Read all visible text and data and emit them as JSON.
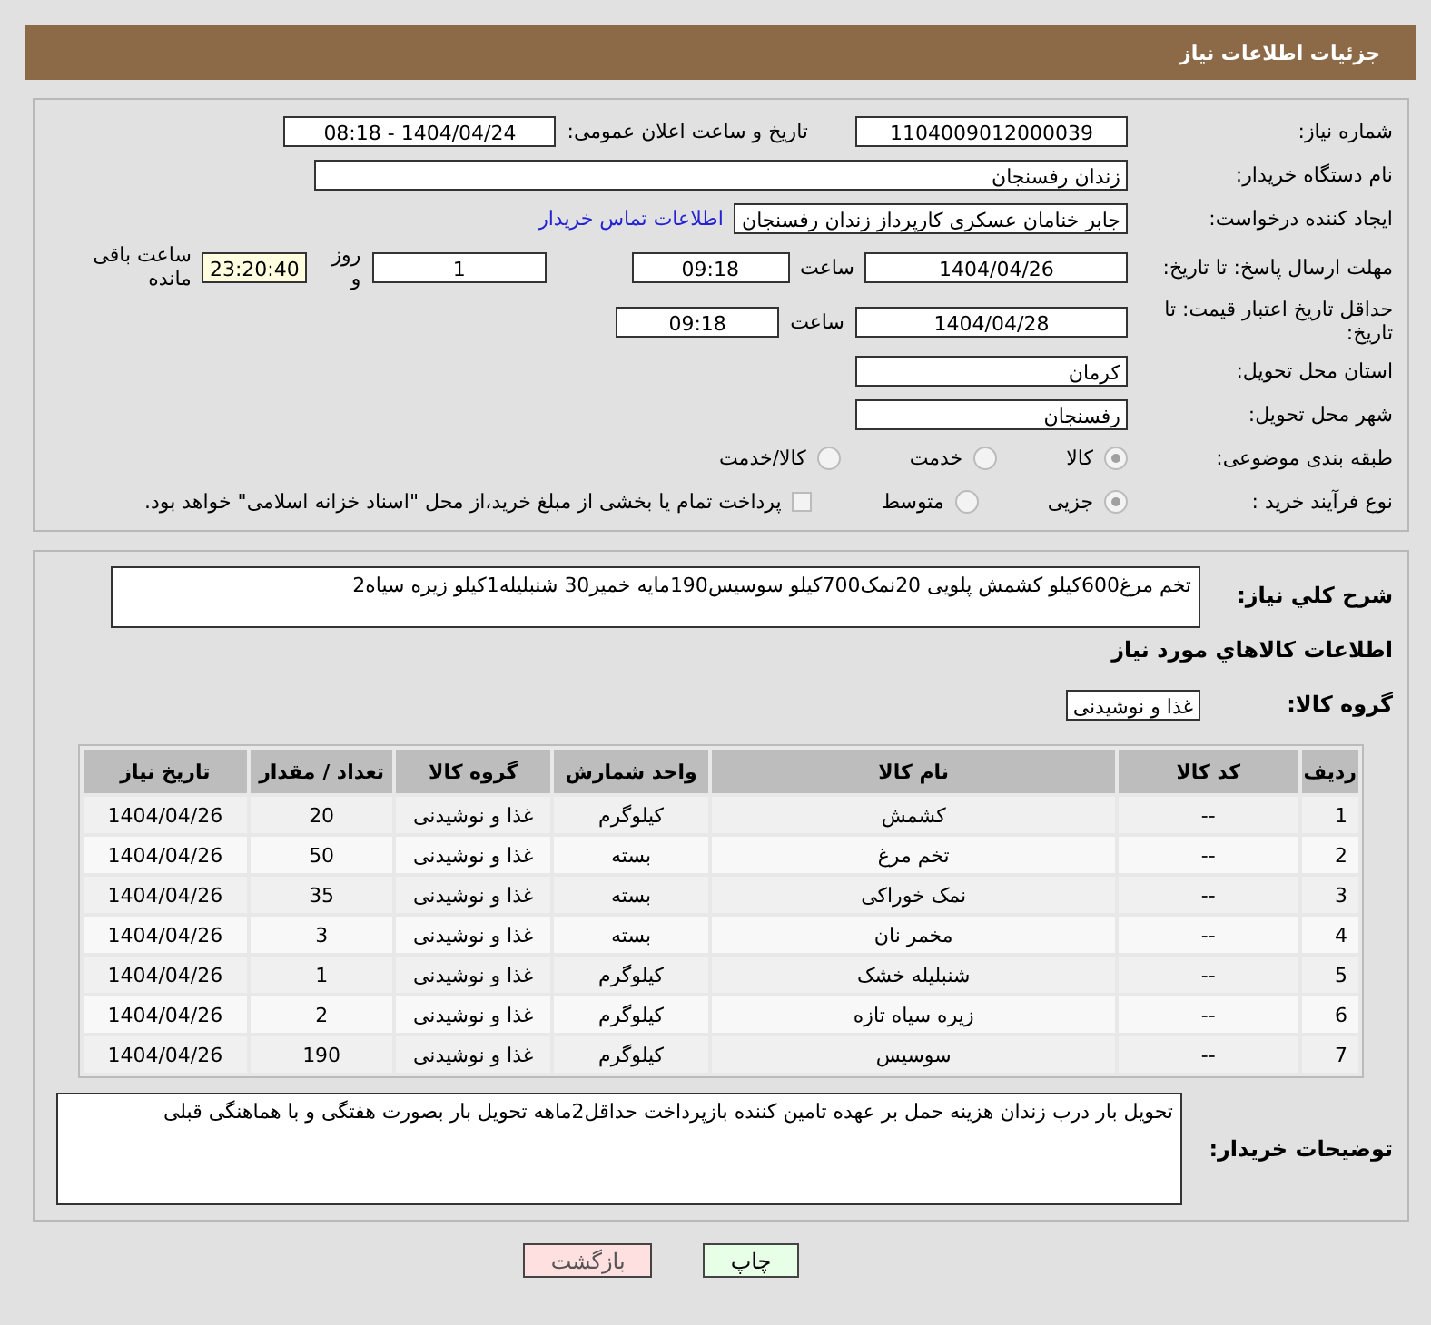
{
  "header": {
    "title": "جزئیات اطلاعات نیاز"
  },
  "form": {
    "need_number": {
      "label": "شماره نیاز:",
      "value": "1104009012000039"
    },
    "announce": {
      "label": "تاریخ و ساعت اعلان عمومی:",
      "value": "1404/04/24 - 08:18"
    },
    "buyer": {
      "label": "نام دستگاه خریدار:",
      "value": "زندان رفسنجان"
    },
    "creator": {
      "label": "ایجاد کننده درخواست:",
      "value": "جابر خنامان عسکری کارپرداز زندان رفسنجان",
      "link": "اطلاعات تماس خریدار"
    },
    "deadline": {
      "label": "مهلت ارسال پاسخ: تا تاریخ:",
      "date": "1404/04/26",
      "time_label": "ساعت",
      "time": "09:18",
      "days": "1",
      "days_label": "روز و",
      "remaining": "23:20:40",
      "remaining_label": "ساعت باقی مانده"
    },
    "validity": {
      "label": "حداقل تاریخ اعتبار قیمت: تا تاریخ:",
      "date": "1404/04/28",
      "time_label": "ساعت",
      "time": "09:18"
    },
    "province": {
      "label": "استان محل تحویل:",
      "value": "کرمان"
    },
    "city": {
      "label": "شهر محل تحویل:",
      "value": "رفسنجان"
    },
    "category": {
      "label": "طبقه بندی موضوعی:",
      "options": [
        {
          "label": "کالا",
          "selected": true
        },
        {
          "label": "خدمت",
          "selected": false
        },
        {
          "label": "کالا/خدمت",
          "selected": false
        }
      ]
    },
    "process": {
      "label": "نوع فرآیند خرید :",
      "options": [
        {
          "label": "جزیی",
          "selected": true
        },
        {
          "label": "متوسط",
          "selected": false
        }
      ],
      "treasury": {
        "label": "پرداخت تمام یا بخشی از مبلغ خرید،از محل \"اسناد خزانه اسلامی\" خواهد بود.",
        "checked": false
      }
    }
  },
  "details": {
    "description": {
      "label": "شرح کلي نياز:",
      "value": "تخم مرغ600کیلو کشمش پلویی 20نمک700کیلو سوسیس190مایه خمیر30 شنبلیله1کیلو زیره سیاه2"
    },
    "items_heading": "اطلاعات كالاهاي مورد نياز",
    "group": {
      "label": "گروه کالا:",
      "value": "غذا و نوشیدنی"
    },
    "table": {
      "columns": [
        "ردیف",
        "کد کالا",
        "نام کالا",
        "واحد شمارش",
        "گروه کالا",
        "تعداد / مقدار",
        "تاریخ نیاز"
      ],
      "rows": [
        [
          "1",
          "--",
          "کشمش",
          "کیلوگرم",
          "غذا و نوشیدنی",
          "20",
          "1404/04/26"
        ],
        [
          "2",
          "--",
          "تخم مرغ",
          "بسته",
          "غذا و نوشیدنی",
          "50",
          "1404/04/26"
        ],
        [
          "3",
          "--",
          "نمک خوراکی",
          "بسته",
          "غذا و نوشیدنی",
          "35",
          "1404/04/26"
        ],
        [
          "4",
          "--",
          "مخمر نان",
          "بسته",
          "غذا و نوشیدنی",
          "3",
          "1404/04/26"
        ],
        [
          "5",
          "--",
          "شنبلیله خشک",
          "کیلوگرم",
          "غذا و نوشیدنی",
          "1",
          "1404/04/26"
        ],
        [
          "6",
          "--",
          "زیره سیاه تازه",
          "کیلوگرم",
          "غذا و نوشیدنی",
          "2",
          "1404/04/26"
        ],
        [
          "7",
          "--",
          "سوسیس",
          "کیلوگرم",
          "غذا و نوشیدنی",
          "190",
          "1404/04/26"
        ]
      ]
    },
    "buyer_notes": {
      "label": "توضیحات خریدار:",
      "value": "تحویل بار درب زندان هزینه حمل بر عهده تامین کننده بازپرداخت حداقل2ماهه تحویل بار بصورت هفتگی و با هماهنگی قبلی"
    }
  },
  "buttons": [
    {
      "label": "چاپ",
      "kind": "print"
    },
    {
      "label": "بازگشت",
      "kind": "back"
    }
  ]
}
